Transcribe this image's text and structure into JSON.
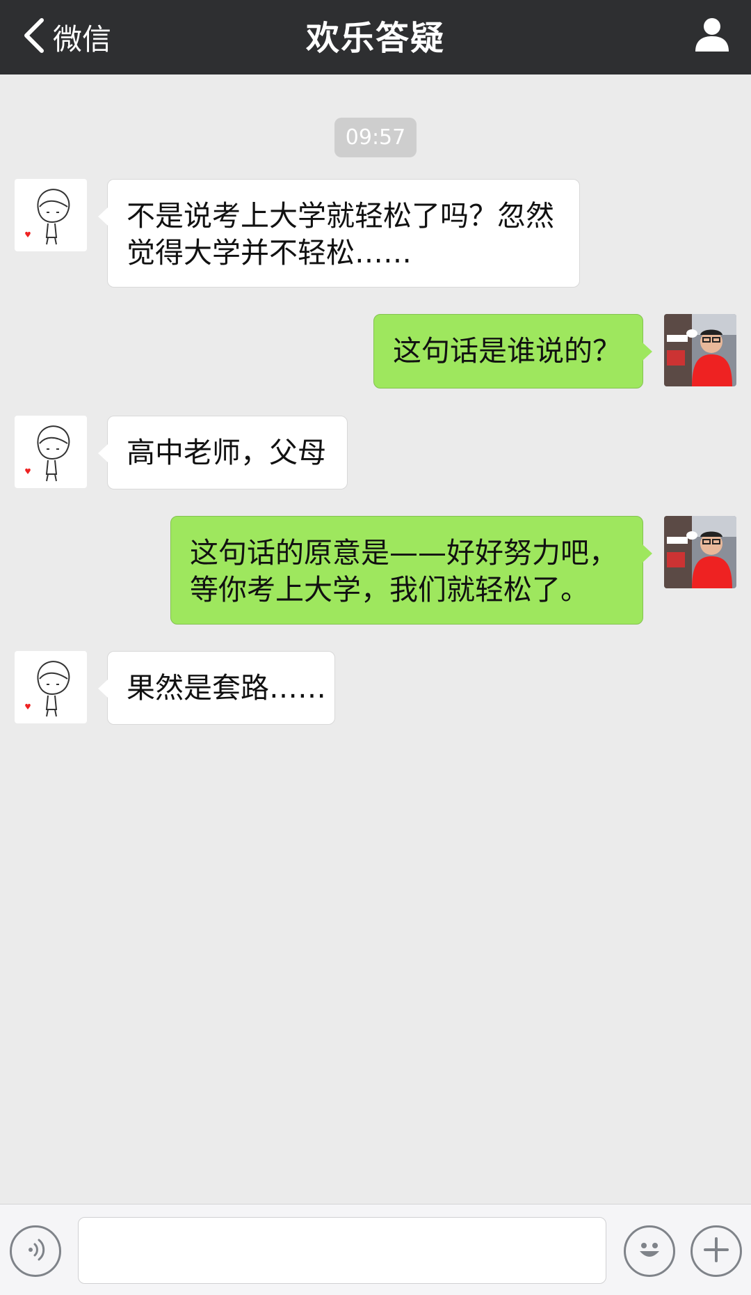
{
  "navbar": {
    "back_label": "微信",
    "title": "欢乐答疑"
  },
  "chat": {
    "timestamp": "09:57",
    "messages": [
      {
        "side": "received",
        "lines": [
          "不是说考上大学就轻松了吗？忽然",
          "觉得大学并不轻松……"
        ]
      },
      {
        "side": "sent",
        "lines": [
          "这句话是谁说的？"
        ]
      },
      {
        "side": "received",
        "lines": [
          "高中老师，父母"
        ]
      },
      {
        "side": "sent",
        "lines": [
          "这句话的原意是——好好努力吧，",
          "等你考上大学，我们就轻松了。"
        ]
      },
      {
        "side": "received",
        "lines": [
          "果然是套路……"
        ]
      }
    ]
  },
  "input": {
    "value": "",
    "placeholder": ""
  },
  "icons": {
    "back": "chevron-left-icon",
    "profile": "person-icon",
    "voice": "voice-icon",
    "emoji": "emoji-icon",
    "more": "plus-icon"
  },
  "colors": {
    "navbar_bg": "#2e2f31",
    "chat_bg": "#ebebeb",
    "sent_bubble": "#9ee75e",
    "received_bubble": "#ffffff",
    "timestamp_bg": "#cecece"
  }
}
